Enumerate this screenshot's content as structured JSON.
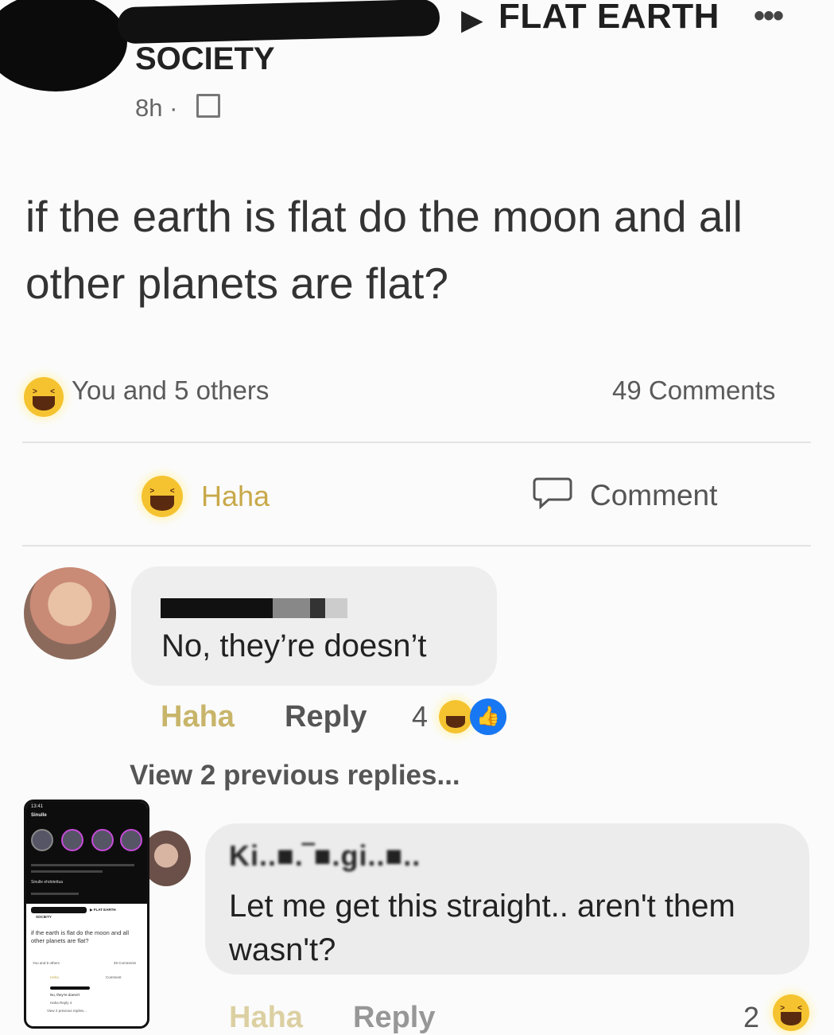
{
  "post": {
    "group_arrow": "▶",
    "group_name": "FLAT EARTH",
    "group_name_line2": "SOCIETY",
    "more_icon": "•••",
    "time": "8h",
    "separator": "·",
    "body": "if the earth is flat do the moon and all other planets are flat?"
  },
  "reactions": {
    "summary": "You and 5 others",
    "comments_count": "49 Comments"
  },
  "actions": {
    "haha_label": "Haha",
    "comment_label": "Comment"
  },
  "comment1": {
    "text": "No, they’re doesn’t",
    "haha": "Haha",
    "reply": "Reply",
    "reaction_count": "4"
  },
  "view_previous": "View 2 previous replies...",
  "comment2": {
    "author": "Ki..■.‾■.gi..■..",
    "text": "Let me get this straight.. aren't them wasn't?",
    "haha": "Haha",
    "reply": "Reply",
    "reaction_count": "2"
  },
  "inset_phone": {
    "status": "13:41",
    "title": "Sinulle",
    "section": "Sinulle ehdotettua",
    "group_name": "▶ FLAT EARTH",
    "society": "SOCIETY",
    "body": "if the earth is flat do the moon and all other planets are flat?",
    "you_others": "You and 5 others",
    "comments": "49 Comments",
    "haha": "Haha",
    "comment": "Comment",
    "c1_text": "No, they're doesn't",
    "c1_actions": "Haha   Reply   4",
    "view_prev": "View 2 previous replies..."
  },
  "colors": {
    "haha_yellow": "#c8b56a",
    "emoji_yellow": "#f5c330",
    "like_blue": "#1877f2",
    "bubble_gray": "#eeeeee"
  },
  "icons": [
    "globe-icon",
    "more-icon",
    "haha-emoji-icon",
    "comment-icon",
    "like-icon"
  ]
}
